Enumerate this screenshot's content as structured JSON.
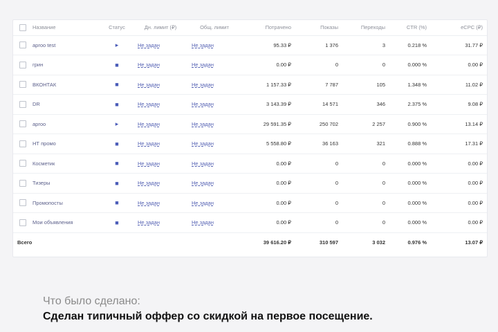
{
  "table": {
    "headers": {
      "name": "Название",
      "status": "Статус",
      "day_limit": "Дн. лимит (₽)",
      "total_limit": "Общ. лимит",
      "spent": "Потрачено",
      "impressions": "Показы",
      "clicks": "Переходы",
      "ctr": "CTR (%)",
      "ecpc": "eCPC (₽)"
    },
    "rows": [
      {
        "name": "aproo test",
        "status": "▸",
        "day_limit": "Не задан",
        "total_limit": "Не задан",
        "spent": "95.33 ₽",
        "impressions": "1 376",
        "clicks": "3",
        "ctr": "0.218 %",
        "ecpc": "31.77 ₽"
      },
      {
        "name": "грин",
        "status": "■",
        "day_limit": "Не задан",
        "total_limit": "Не задан",
        "spent": "0.00 ₽",
        "impressions": "0",
        "clicks": "0",
        "ctr": "0.000 %",
        "ecpc": "0.00 ₽"
      },
      {
        "name": "ВКОНТАК",
        "status": "■",
        "day_limit": "Не задан",
        "total_limit": "Не задан",
        "spent": "1 157.33 ₽",
        "impressions": "7 787",
        "clicks": "105",
        "ctr": "1.348 %",
        "ecpc": "11.02 ₽"
      },
      {
        "name": "DR",
        "status": "■",
        "day_limit": "Не задан",
        "total_limit": "Не задан",
        "spent": "3 143.39 ₽",
        "impressions": "14 571",
        "clicks": "346",
        "ctr": "2.375 %",
        "ecpc": "9.08 ₽"
      },
      {
        "name": "aproo",
        "status": "▸",
        "day_limit": "Не задан",
        "total_limit": "Не задан",
        "spent": "29 591.35 ₽",
        "impressions": "250 702",
        "clicks": "2 257",
        "ctr": "0.900 %",
        "ecpc": "13.14 ₽"
      },
      {
        "name": "НТ промо",
        "status": "■",
        "day_limit": "Не задан",
        "total_limit": "Не задан",
        "spent": "5 558.80 ₽",
        "impressions": "36 163",
        "clicks": "321",
        "ctr": "0.888 %",
        "ecpc": "17.31 ₽"
      },
      {
        "name": "Косметик",
        "status": "■",
        "day_limit": "Не задан",
        "total_limit": "Не задан",
        "spent": "0.00 ₽",
        "impressions": "0",
        "clicks": "0",
        "ctr": "0.000 %",
        "ecpc": "0.00 ₽"
      },
      {
        "name": "Тизеры",
        "status": "■",
        "day_limit": "Не задан",
        "total_limit": "Не задан",
        "spent": "0.00 ₽",
        "impressions": "0",
        "clicks": "0",
        "ctr": "0.000 %",
        "ecpc": "0.00 ₽"
      },
      {
        "name": "Промопосты",
        "status": "■",
        "day_limit": "Не задан",
        "total_limit": "Не задан",
        "spent": "0.00 ₽",
        "impressions": "0",
        "clicks": "0",
        "ctr": "0.000 %",
        "ecpc": "0.00 ₽"
      },
      {
        "name": "Мои объявления",
        "status": "■",
        "day_limit": "Не задан",
        "total_limit": "Не задан",
        "spent": "0.00 ₽",
        "impressions": "0",
        "clicks": "0",
        "ctr": "0.000 %",
        "ecpc": "0.00 ₽"
      }
    ],
    "total": {
      "label": "Всего",
      "spent": "39 616.20 ₽",
      "impressions": "310 597",
      "clicks": "3 032",
      "ctr": "0.976 %",
      "ecpc": "13.07 ₽"
    }
  },
  "footer": {
    "done_label": "Что было сделано:",
    "done_text": "Сделан типичный оффер со скидкой на первое посещение."
  },
  "colors": {
    "link": "#5461b3",
    "status_icon": "#4a5bb8",
    "header_text": "#8c8f99"
  }
}
